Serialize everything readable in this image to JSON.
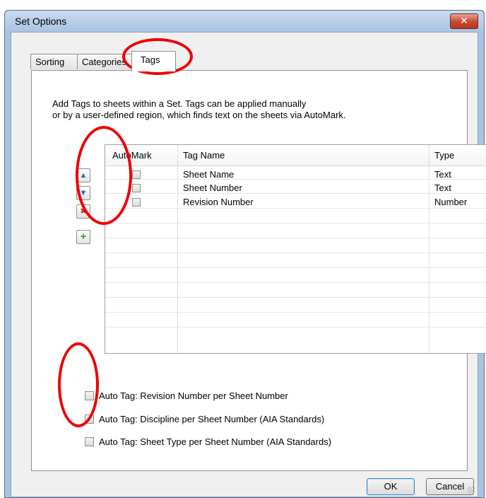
{
  "window": {
    "title": "Set Options",
    "close_glyph": "✕"
  },
  "tabs": [
    {
      "label": "Sorting"
    },
    {
      "label": "Categories"
    },
    {
      "label": "Tags"
    }
  ],
  "description": {
    "line1": "Add Tags to sheets within a Set. Tags can be applied manually",
    "line2": "or by a user-defined region,  which finds text on the sheets via AutoMark."
  },
  "grid": {
    "headers": {
      "automark": "AutoMark",
      "tag_name": "Tag Name",
      "type": "Type"
    },
    "rows": [
      {
        "automark": false,
        "tag_name": "Sheet Name",
        "type": "Text"
      },
      {
        "automark": false,
        "tag_name": "Sheet Number",
        "type": "Text"
      },
      {
        "automark": false,
        "tag_name": "Revision Number",
        "type": "Number"
      }
    ]
  },
  "side_buttons": [
    {
      "icon": "arrow-up-icon",
      "glyph": "▲",
      "color": "#1a6fc9"
    },
    {
      "icon": "arrow-down-icon",
      "glyph": "▼",
      "color": "#1a6fc9"
    },
    {
      "icon": "delete-x-icon",
      "glyph": "✖",
      "color": "#d01c1c"
    },
    {
      "icon": "add-plus-icon",
      "glyph": "+",
      "color": "#3aa33a"
    }
  ],
  "auto_tags": [
    {
      "label": "Auto Tag: Revision Number per Sheet Number",
      "checked": false
    },
    {
      "label": "Auto Tag: Discipline per Sheet Number (AIA Standards)",
      "checked": false
    },
    {
      "label": "Auto Tag: Sheet Type per Sheet Number (AIA Standards)",
      "checked": false
    }
  ],
  "buttons": {
    "ok": "OK",
    "cancel": "Cancel"
  },
  "colors": {
    "annotation": "#ee0000",
    "title_bar": "#aac4e3",
    "close_button": "#c9462c"
  }
}
